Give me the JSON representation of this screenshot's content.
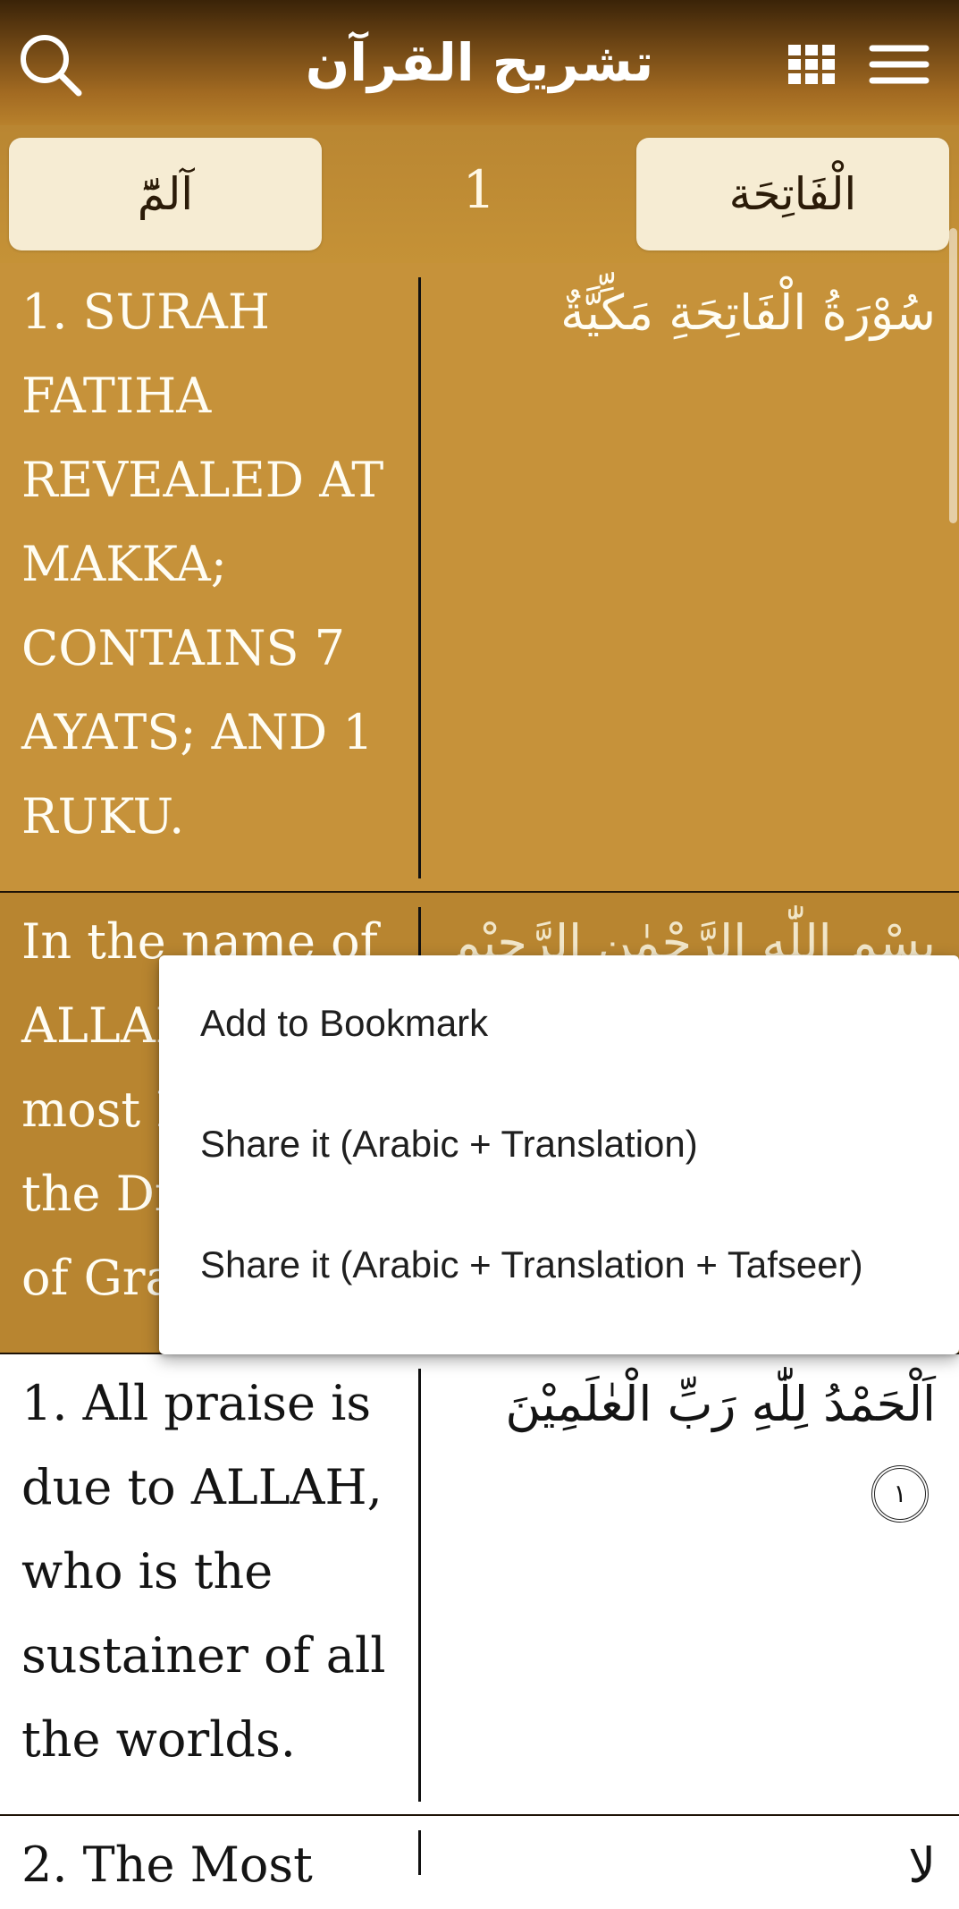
{
  "app_bar": {
    "title": "تشريح القرآن",
    "icons": [
      "search-icon",
      "grid-icon",
      "hamburger-menu-icon"
    ],
    "colors": {
      "top": "#3a2308",
      "bottom": "#b8812c"
    }
  },
  "navigation": {
    "prev_surah": "آلمّٓ",
    "current_number": "1",
    "next_surah": "الْفَاتِحَة"
  },
  "rows": [
    {
      "translation": "1. SURAH FATIHA REVEALED AT MAKKA; CONTAINS 7 AYATS; AND 1 RUKU.",
      "arabic": "سُوْرَةُ الْفَاتِحَةِ مَكِّيَّةٌ",
      "background": "#c6923a"
    },
    {
      "translation": "In the name of ALLAH the most Merciful the Dispenser of Grace.",
      "arabic": "بِسْمِ اللّٰهِ الرَّحْمٰنِ الرَّحِيْمِ",
      "background": "#b88530"
    },
    {
      "translation": "1. All praise is due to ALLAH, who is the sustainer of all the worlds.",
      "arabic": "اَلْحَمْدُ لِلّٰهِ رَبِّ الْعٰلَمِيْنَ",
      "ayah_number": "١",
      "background": "#ffffff"
    },
    {
      "translation": "2. The Most",
      "arabic": "لا",
      "background": "#ffffff"
    }
  ],
  "context_menu": {
    "items": [
      "Add to Bookmark",
      "Share it (Arabic + Translation)",
      "Share it (Arabic + Translation + Tafseer)"
    ]
  }
}
